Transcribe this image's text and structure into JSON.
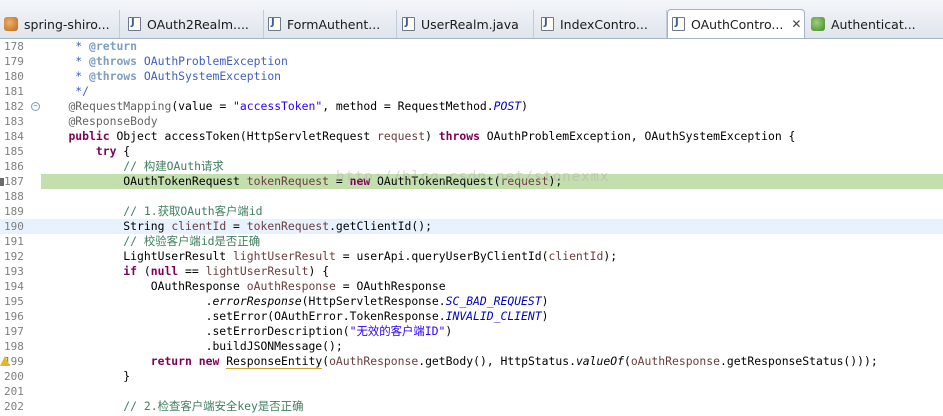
{
  "tabs": [
    {
      "label": "spring-shiro...",
      "icon": "tool-icon",
      "active": false
    },
    {
      "label": "OAuth2Realm....",
      "icon": "java-file-icon",
      "active": false
    },
    {
      "label": "FormAuthent...",
      "icon": "java-file-icon",
      "active": false
    },
    {
      "label": "UserRealm.java",
      "icon": "java-file-icon",
      "active": false
    },
    {
      "label": "IndexContro...",
      "icon": "java-file-icon",
      "active": false
    },
    {
      "label": "OAuthContro...",
      "icon": "java-file-icon",
      "active": true,
      "close": "✕"
    },
    {
      "label": "Authenticat...",
      "icon": "class-icon",
      "active": false
    }
  ],
  "editor": {
    "lines": [
      {
        "n": "178",
        "text": "     * @return"
      },
      {
        "n": "179",
        "text": "     * @throws OAuthProblemException"
      },
      {
        "n": "180",
        "text": "     * @throws OAuthSystemException"
      },
      {
        "n": "181",
        "text": "     */"
      },
      {
        "n": "182",
        "text": "    @RequestMapping(value = \"accessToken\", method = RequestMethod.POST)"
      },
      {
        "n": "183",
        "text": "    @ResponseBody"
      },
      {
        "n": "184",
        "text": "    public Object accessToken(HttpServletRequest request) throws OAuthProblemException, OAuthSystemException {"
      },
      {
        "n": "185",
        "text": "        try {"
      },
      {
        "n": "186",
        "text": "            // 构建OAuth请求"
      },
      {
        "n": "187",
        "text": "            OAuthTokenRequest tokenRequest = new OAuthTokenRequest(request);"
      },
      {
        "n": "188",
        "text": ""
      },
      {
        "n": "189",
        "text": "            // 1.获取OAuth客户端id"
      },
      {
        "n": "190",
        "text": "            String clientId = tokenRequest.getClientId();"
      },
      {
        "n": "191",
        "text": "            // 校验客户端id是否正确"
      },
      {
        "n": "192",
        "text": "            LightUserResult lightUserResult = userApi.queryUserByClientId(clientId);"
      },
      {
        "n": "193",
        "text": "            if (null == lightUserResult) {"
      },
      {
        "n": "194",
        "text": "                OAuthResponse oAuthResponse = OAuthResponse"
      },
      {
        "n": "195",
        "text": "                        .errorResponse(HttpServletResponse.SC_BAD_REQUEST)"
      },
      {
        "n": "196",
        "text": "                        .setError(OAuthError.TokenResponse.INVALID_CLIENT)"
      },
      {
        "n": "197",
        "text": "                        .setErrorDescription(\"无效的客户端ID\")"
      },
      {
        "n": "198",
        "text": "                        .buildJSONMessage();"
      },
      {
        "n": "199",
        "text": "                return new ResponseEntity(oAuthResponse.getBody(), HttpStatus.valueOf(oAuthResponse.getResponseStatus()));"
      },
      {
        "n": "200",
        "text": "            }"
      },
      {
        "n": "201",
        "text": ""
      },
      {
        "n": "202",
        "text": "            // 2.检查客户端安全key是否正确"
      }
    ],
    "current_line": "190",
    "highlighted_line": "187",
    "warning_line": "199",
    "watermark": "http://blog.csdn.net/stonexmx"
  },
  "colors": {
    "keyword": "#7f0055",
    "comment": "#3f7f5f",
    "javadoc": "#3f5fbf",
    "string": "#2a00ff",
    "annotation": "#646464",
    "local_variable": "#6a3e3e",
    "static_field": "#0000c0",
    "current_line_bg": "#e8f2fe",
    "occurrence_bg": "#c4dfae"
  }
}
